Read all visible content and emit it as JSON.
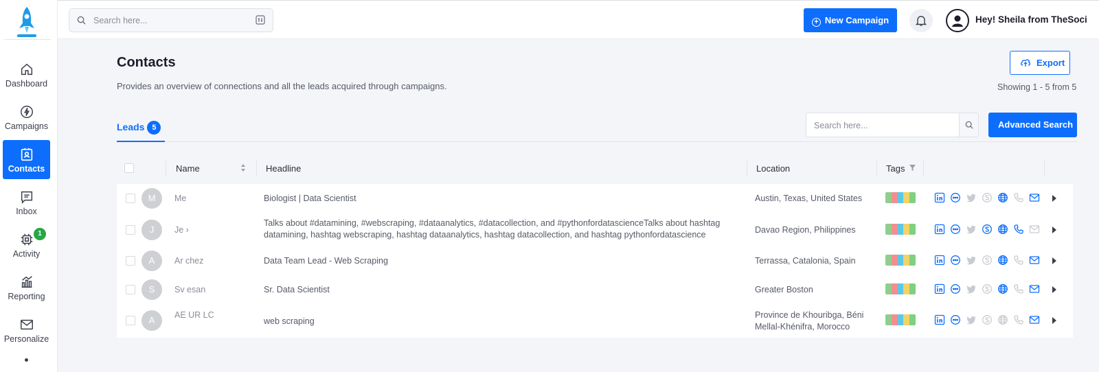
{
  "sidebar": {
    "items": [
      {
        "label": "Dashboard",
        "icon": "home-icon"
      },
      {
        "label": "Campaigns",
        "icon": "lightning-icon"
      },
      {
        "label": "Contacts",
        "icon": "contacts-icon",
        "active": true
      },
      {
        "label": "Inbox",
        "icon": "inbox-icon"
      },
      {
        "label": "Activity",
        "icon": "activity-icon",
        "badge": "1"
      },
      {
        "label": "Reporting",
        "icon": "reporting-icon"
      },
      {
        "label": "Personalize",
        "icon": "mail-icon"
      }
    ]
  },
  "topbar": {
    "search_placeholder": "Search here...",
    "new_campaign_label": "New Campaign",
    "greeting": "Hey! Sheila from TheSoci"
  },
  "page": {
    "title": "Contacts",
    "subtitle": "Provides an overview of connections and all the leads acquired through campaigns.",
    "export_label": "Export",
    "showing": "Showing 1 - 5 from 5"
  },
  "tabs": {
    "leads_label": "Leads",
    "leads_count": "5"
  },
  "lead_search": {
    "placeholder": "Search here...",
    "advanced_label": "Advanced Search"
  },
  "table": {
    "headers": {
      "name": "Name",
      "headline": "Headline",
      "location": "Location",
      "tags": "Tags"
    },
    "rows": [
      {
        "initial": "M",
        "name": "Mе",
        "headline": "Biologist | Data Scientist",
        "location": "Austin, Texas, United States",
        "icons_on": [
          1,
          1,
          0,
          0,
          1,
          0,
          1
        ]
      },
      {
        "initial": "J",
        "name": "Je                 ›",
        "headline": "Talks about #datamining, #webscraping, #dataanalytics, #datacollection, and #pythonfordatascienceTalks about hashtag datamining, hashtag webscraping, hashtag dataanalytics, hashtag datacollection, and hashtag pythonfordatascience",
        "location": "Davao Region, Philippines",
        "icons_on": [
          1,
          1,
          0,
          1,
          1,
          1,
          0
        ]
      },
      {
        "initial": "A",
        "name": "Ar                 chez",
        "headline": "Data Team Lead - Web Scraping",
        "location": "Terrassa, Catalonia, Spain",
        "icons_on": [
          1,
          1,
          0,
          0,
          1,
          0,
          1
        ]
      },
      {
        "initial": "S",
        "name": "Sv                 esan",
        "headline": "Sr. Data Scientist",
        "location": "Greater Boston",
        "icons_on": [
          1,
          1,
          0,
          0,
          1,
          0,
          1
        ]
      },
      {
        "initial": "A",
        "name": "AE                UR LC",
        "headline": "web scraping",
        "location": "Province de Khouribga, Béni Mellal-Khénifra, Morocco",
        "icons_on": [
          1,
          1,
          0,
          0,
          0,
          0,
          1
        ]
      }
    ],
    "row_icons": [
      "linkedin-icon",
      "chat-icon",
      "twitter-icon",
      "skype-icon",
      "globe-icon",
      "phone-icon",
      "mail-icon"
    ],
    "tag_colors": [
      "#8fce8f",
      "#f28e8e",
      "#5bc8e8",
      "#f2d36b",
      "#7fd17f"
    ]
  },
  "colors": {
    "accent": "#0d6efd",
    "badge_green": "#28a745"
  }
}
